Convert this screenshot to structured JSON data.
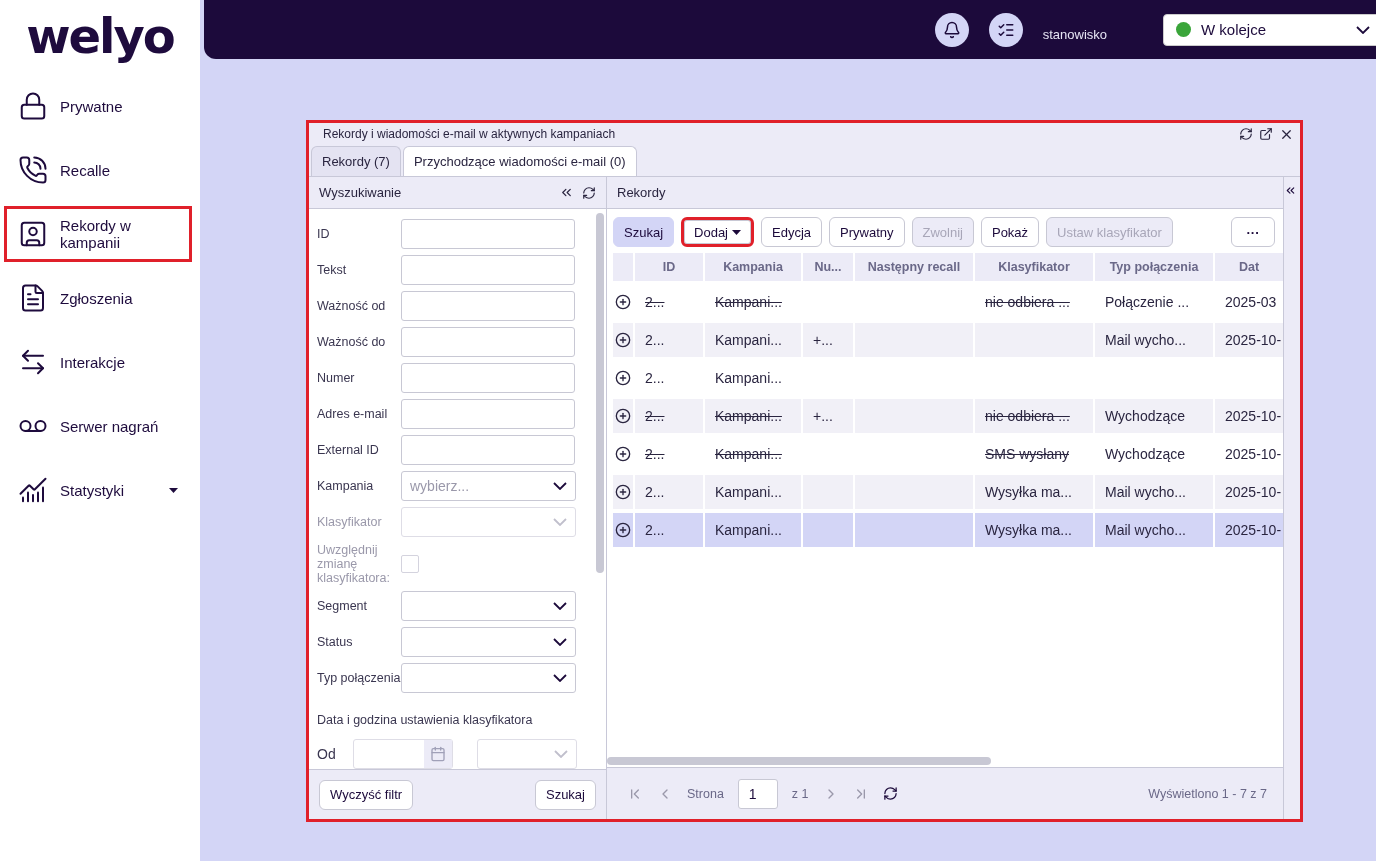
{
  "logo": "welyo",
  "sidebar": {
    "items": [
      {
        "label": "Prywatne",
        "highlighted": false,
        "has_caret": false
      },
      {
        "label": "Recalle",
        "highlighted": false,
        "has_caret": false
      },
      {
        "label": "Rekordy w kampanii",
        "highlighted": true,
        "has_caret": false
      },
      {
        "label": "Zgłoszenia",
        "highlighted": false,
        "has_caret": false
      },
      {
        "label": "Interakcje",
        "highlighted": false,
        "has_caret": false
      },
      {
        "label": "Serwer nagrań",
        "highlighted": false,
        "has_caret": false
      },
      {
        "label": "Statystyki",
        "highlighted": false,
        "has_caret": true
      }
    ]
  },
  "topbar": {
    "workstation": "stanowisko",
    "status": {
      "label": "W kolejce",
      "color": "#3aa53a"
    }
  },
  "window": {
    "title": "Rekordy i wiadomości e-mail w aktywnych kampaniach",
    "highlighted": true,
    "tabs": [
      {
        "label": "Rekordy (7)",
        "selected": false
      },
      {
        "label": "Przychodzące wiadomości e-mail (0)",
        "selected": true
      }
    ],
    "search_panel": {
      "title": "Wyszukiwanie",
      "fields": [
        {
          "label": "ID",
          "kind": "text",
          "disabled": false
        },
        {
          "label": "Tekst",
          "kind": "text",
          "disabled": false
        },
        {
          "label": "Ważność od",
          "kind": "text",
          "disabled": false
        },
        {
          "label": "Ważność do",
          "kind": "text",
          "disabled": false
        },
        {
          "label": "Numer",
          "kind": "text",
          "disabled": false
        },
        {
          "label": "Adres e-mail",
          "kind": "text",
          "disabled": false
        },
        {
          "label": "External ID",
          "kind": "text",
          "disabled": false
        },
        {
          "label": "Kampania",
          "kind": "select",
          "placeholder": "wybierz...",
          "disabled": false
        },
        {
          "label": "Klasyfikator",
          "kind": "select",
          "disabled": true
        },
        {
          "label": "Uwzględnij zmianę klasyfikatora:",
          "kind": "checkbox",
          "checked": false,
          "disabled": true
        },
        {
          "label": "Segment",
          "kind": "select",
          "disabled": false
        },
        {
          "label": "Status",
          "kind": "select",
          "disabled": false
        },
        {
          "label": "Typ połączenia",
          "kind": "select",
          "disabled": false
        }
      ],
      "section_title": "Data i godzina ustawienia klasyfikatora",
      "date_label": "Od",
      "buttons": [
        "Wyczyść filtr",
        "Szukaj"
      ]
    },
    "records": {
      "title": "Rekordy",
      "toolbar": [
        {
          "label": "Szukaj",
          "kind": "primary",
          "disabled": false,
          "highlighted": false,
          "has_caret": false
        },
        {
          "label": "Dodaj",
          "kind": "normal",
          "disabled": false,
          "highlighted": true,
          "has_caret": true
        },
        {
          "label": "Edycja",
          "kind": "normal",
          "disabled": false,
          "highlighted": false,
          "has_caret": false
        },
        {
          "label": "Prywatny",
          "kind": "normal",
          "disabled": false,
          "highlighted": false,
          "has_caret": false
        },
        {
          "label": "Zwolnij",
          "kind": "normal",
          "disabled": true,
          "highlighted": false,
          "has_caret": false
        },
        {
          "label": "Pokaż",
          "kind": "normal",
          "disabled": false,
          "highlighted": false,
          "has_caret": false
        },
        {
          "label": "Ustaw klasyfikator",
          "kind": "normal",
          "disabled": true,
          "highlighted": false,
          "has_caret": false
        },
        {
          "label": "···",
          "kind": "more",
          "disabled": false,
          "highlighted": false,
          "has_caret": false
        }
      ],
      "columns": [
        "ID",
        "Kampania",
        "Nu...",
        "Następny recall",
        "Klasyfikator",
        "Typ połączenia",
        "Dat"
      ],
      "rows": [
        {
          "cells": [
            "2...",
            "Kampani...",
            "",
            "",
            "nie odbiera ...",
            "Połączenie ...",
            "2025-03"
          ],
          "struck": true,
          "selected": false
        },
        {
          "cells": [
            "2...",
            "Kampani...",
            "+...",
            "",
            "",
            "Mail wycho...",
            "2025-10-"
          ],
          "struck": false,
          "selected": false
        },
        {
          "cells": [
            "2...",
            "Kampani...",
            "",
            "",
            "",
            "",
            ""
          ],
          "struck": false,
          "selected": false
        },
        {
          "cells": [
            "2...",
            "Kampani...",
            "+...",
            "",
            "nie odbiera ...",
            "Wychodzące",
            "2025-10-"
          ],
          "struck": true,
          "selected": false
        },
        {
          "cells": [
            "2...",
            "Kampani...",
            "",
            "",
            "SMS wysłany",
            "Wychodzące",
            "2025-10-"
          ],
          "struck": true,
          "selected": false
        },
        {
          "cells": [
            "2...",
            "Kampani...",
            "",
            "",
            "Wysyłka ma...",
            "Mail wycho...",
            "2025-10-"
          ],
          "struck": false,
          "selected": false
        },
        {
          "cells": [
            "2...",
            "Kampani...",
            "",
            "",
            "Wysyłka ma...",
            "Mail wycho...",
            "2025-10-"
          ],
          "struck": false,
          "selected": true
        }
      ],
      "pager": {
        "page_label": "Strona",
        "page": "1",
        "of": "z 1",
        "summary": "Wyświetlono 1 - 7 z 7"
      }
    }
  }
}
